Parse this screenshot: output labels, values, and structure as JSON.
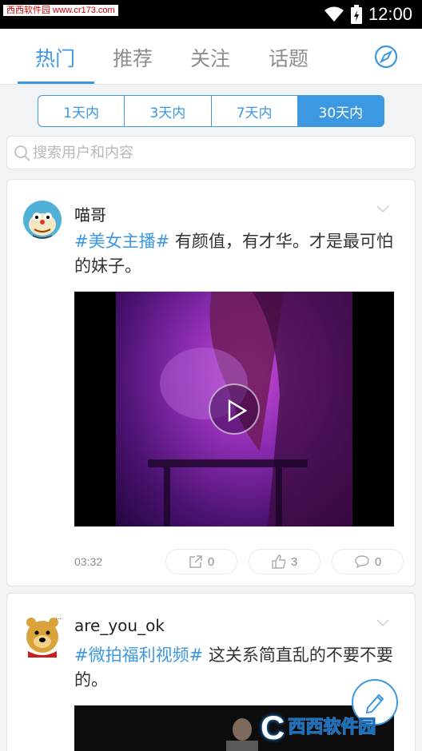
{
  "status_bar": {
    "watermark": "西西软件园 www.cr173.com",
    "time": "12:00"
  },
  "tabs": [
    {
      "label": "热门",
      "active": true
    },
    {
      "label": "推荐",
      "active": false
    },
    {
      "label": "关注",
      "active": false
    },
    {
      "label": "话题",
      "active": false
    }
  ],
  "filter": {
    "options": [
      "1天内",
      "3天内",
      "7天内",
      "30天内"
    ],
    "selected": "30天内"
  },
  "search": {
    "placeholder": "搜索用户和内容"
  },
  "posts": [
    {
      "username": "喵哥",
      "hashtag": "#美女主播#",
      "text": " 有颜值，有才华。才是最可怕的妹子。",
      "duration": "03:32",
      "forward_count": "0",
      "like_count": "3",
      "comment_count": "0"
    },
    {
      "username": "are_you_ok",
      "hashtag": "#微拍福利视频#",
      "text": " 这关系简直乱的不要不要的。"
    }
  ],
  "brand": {
    "mark": "C",
    "text": "西西软件园"
  },
  "colors": {
    "accent": "#3c98e0",
    "background": "#f2f3f5"
  }
}
